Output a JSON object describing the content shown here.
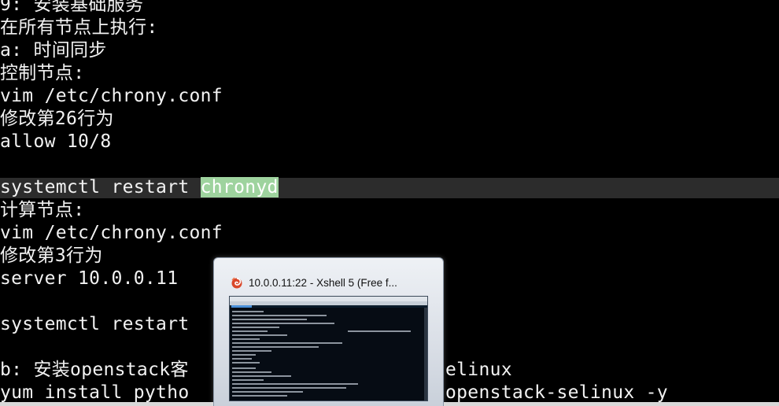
{
  "editor": {
    "lines": [
      "9: 安装基础服务",
      "在所有节点上执行:",
      "a: 时间同步",
      "控制节点:",
      "vim /etc/chrony.conf",
      "修改第26行为",
      "allow 10/8",
      "",
      "systemctl restart ",
      "计算节点:",
      "vim /etc/chrony.conf",
      "修改第3行为",
      "server 10.0.0.11",
      "",
      "systemctl restart",
      "",
      "b: 安装openstack客",
      "yum install pytho"
    ],
    "highlighted_word": "chronyd",
    "right_fragments": {
      "line16": "elinux",
      "line17": "openstack-selinux -y"
    }
  },
  "taskbar_preview": {
    "title": "10.0.0.11:22 - Xshell 5 (Free f...",
    "app_icon": "xshell-icon"
  },
  "colors": {
    "background": "#000000",
    "text": "#f2f2f2",
    "cursor_line": "#2c2c2c",
    "search_highlight": "#9ed39e"
  }
}
